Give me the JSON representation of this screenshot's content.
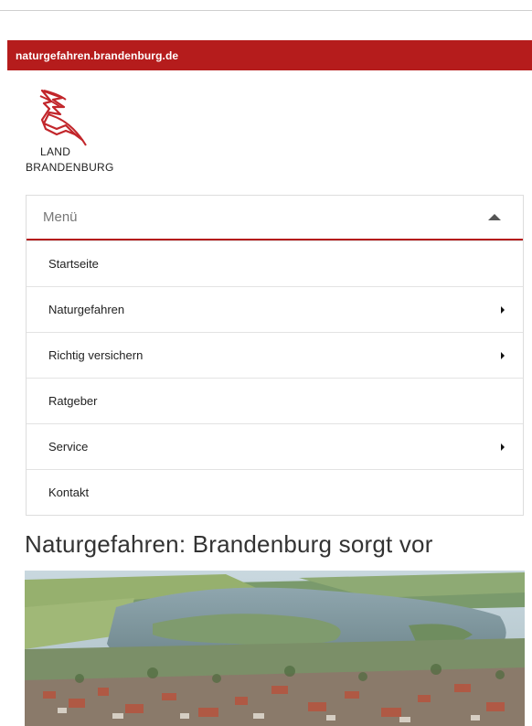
{
  "site_bar": {
    "domain_text": "naturgefahren.brandenburg.de"
  },
  "logo": {
    "line1": "LAND",
    "line2": "BRANDENBURG"
  },
  "menu": {
    "title": "Menü",
    "items": [
      {
        "label": "Startseite",
        "has_submenu": false
      },
      {
        "label": "Naturgefahren",
        "has_submenu": true
      },
      {
        "label": "Richtig versichern",
        "has_submenu": true
      },
      {
        "label": "Ratgeber",
        "has_submenu": false
      },
      {
        "label": "Service",
        "has_submenu": true
      },
      {
        "label": "Kontakt",
        "has_submenu": false
      }
    ]
  },
  "main": {
    "headline": "Naturgefahren: Brandenburg sorgt vor"
  },
  "colors": {
    "brand_red": "#b51c1c",
    "text": "#333333"
  }
}
